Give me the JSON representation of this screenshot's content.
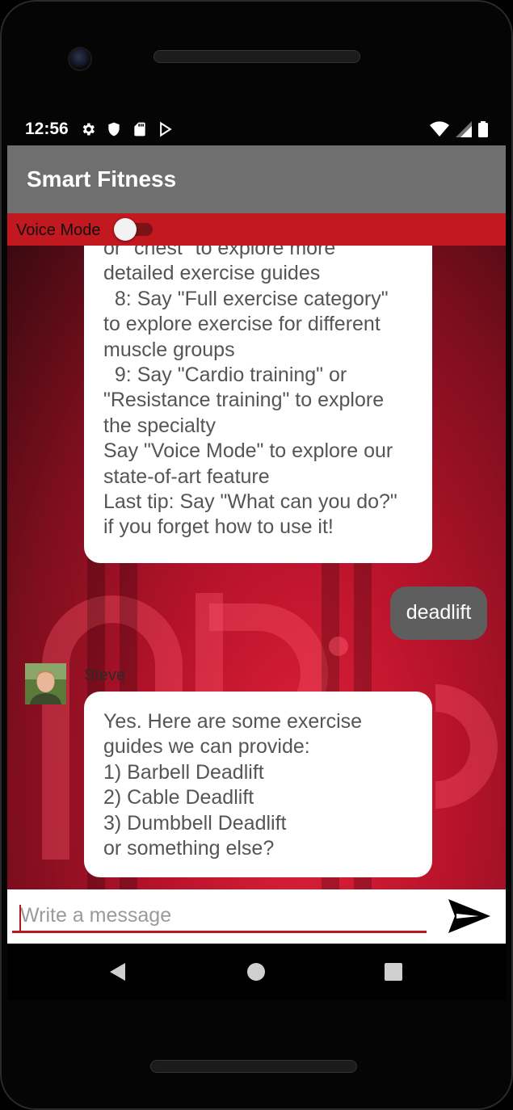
{
  "statusbar": {
    "time": "12:56",
    "left_icons": [
      "gear-icon",
      "shield-icon",
      "sd-card-icon",
      "play-store-icon"
    ],
    "right_icons": [
      "wifi-icon",
      "cell-signal-icon",
      "battery-icon"
    ]
  },
  "appbar": {
    "title": "Smart Fitness",
    "color": "#6f6f6f"
  },
  "voice_mode": {
    "label": "Voice Mode",
    "enabled": false,
    "bar_color": "#c1191f"
  },
  "messages": [
    {
      "from": "bot",
      "text": "or \"chest\" to explore more\ndetailed exercise guides\n  8: Say \"Full exercise category\"\nto explore exercise for different\nmuscle groups\n  9: Say \"Cardio training\" or\n\"Resistance training\" to explore\nthe specialty\nSay \"Voice Mode\" to explore our\nstate-of-art feature\nLast tip: Say \"What can you do?\"\nif you forget how to use it!"
    },
    {
      "from": "user",
      "text": "deadlift"
    },
    {
      "from": "bot",
      "sender": "Steve",
      "text": "Yes. Here are some exercise\nguides we can provide:\n1) Barbell Deadlift\n2) Cable Deadlift\n3) Dumbbell Deadlift\nor something else?"
    }
  ],
  "composer": {
    "placeholder": "Write a message",
    "send_icon": "send-icon"
  },
  "navbar": {
    "buttons": [
      "back-icon",
      "home-icon",
      "recents-icon"
    ]
  }
}
